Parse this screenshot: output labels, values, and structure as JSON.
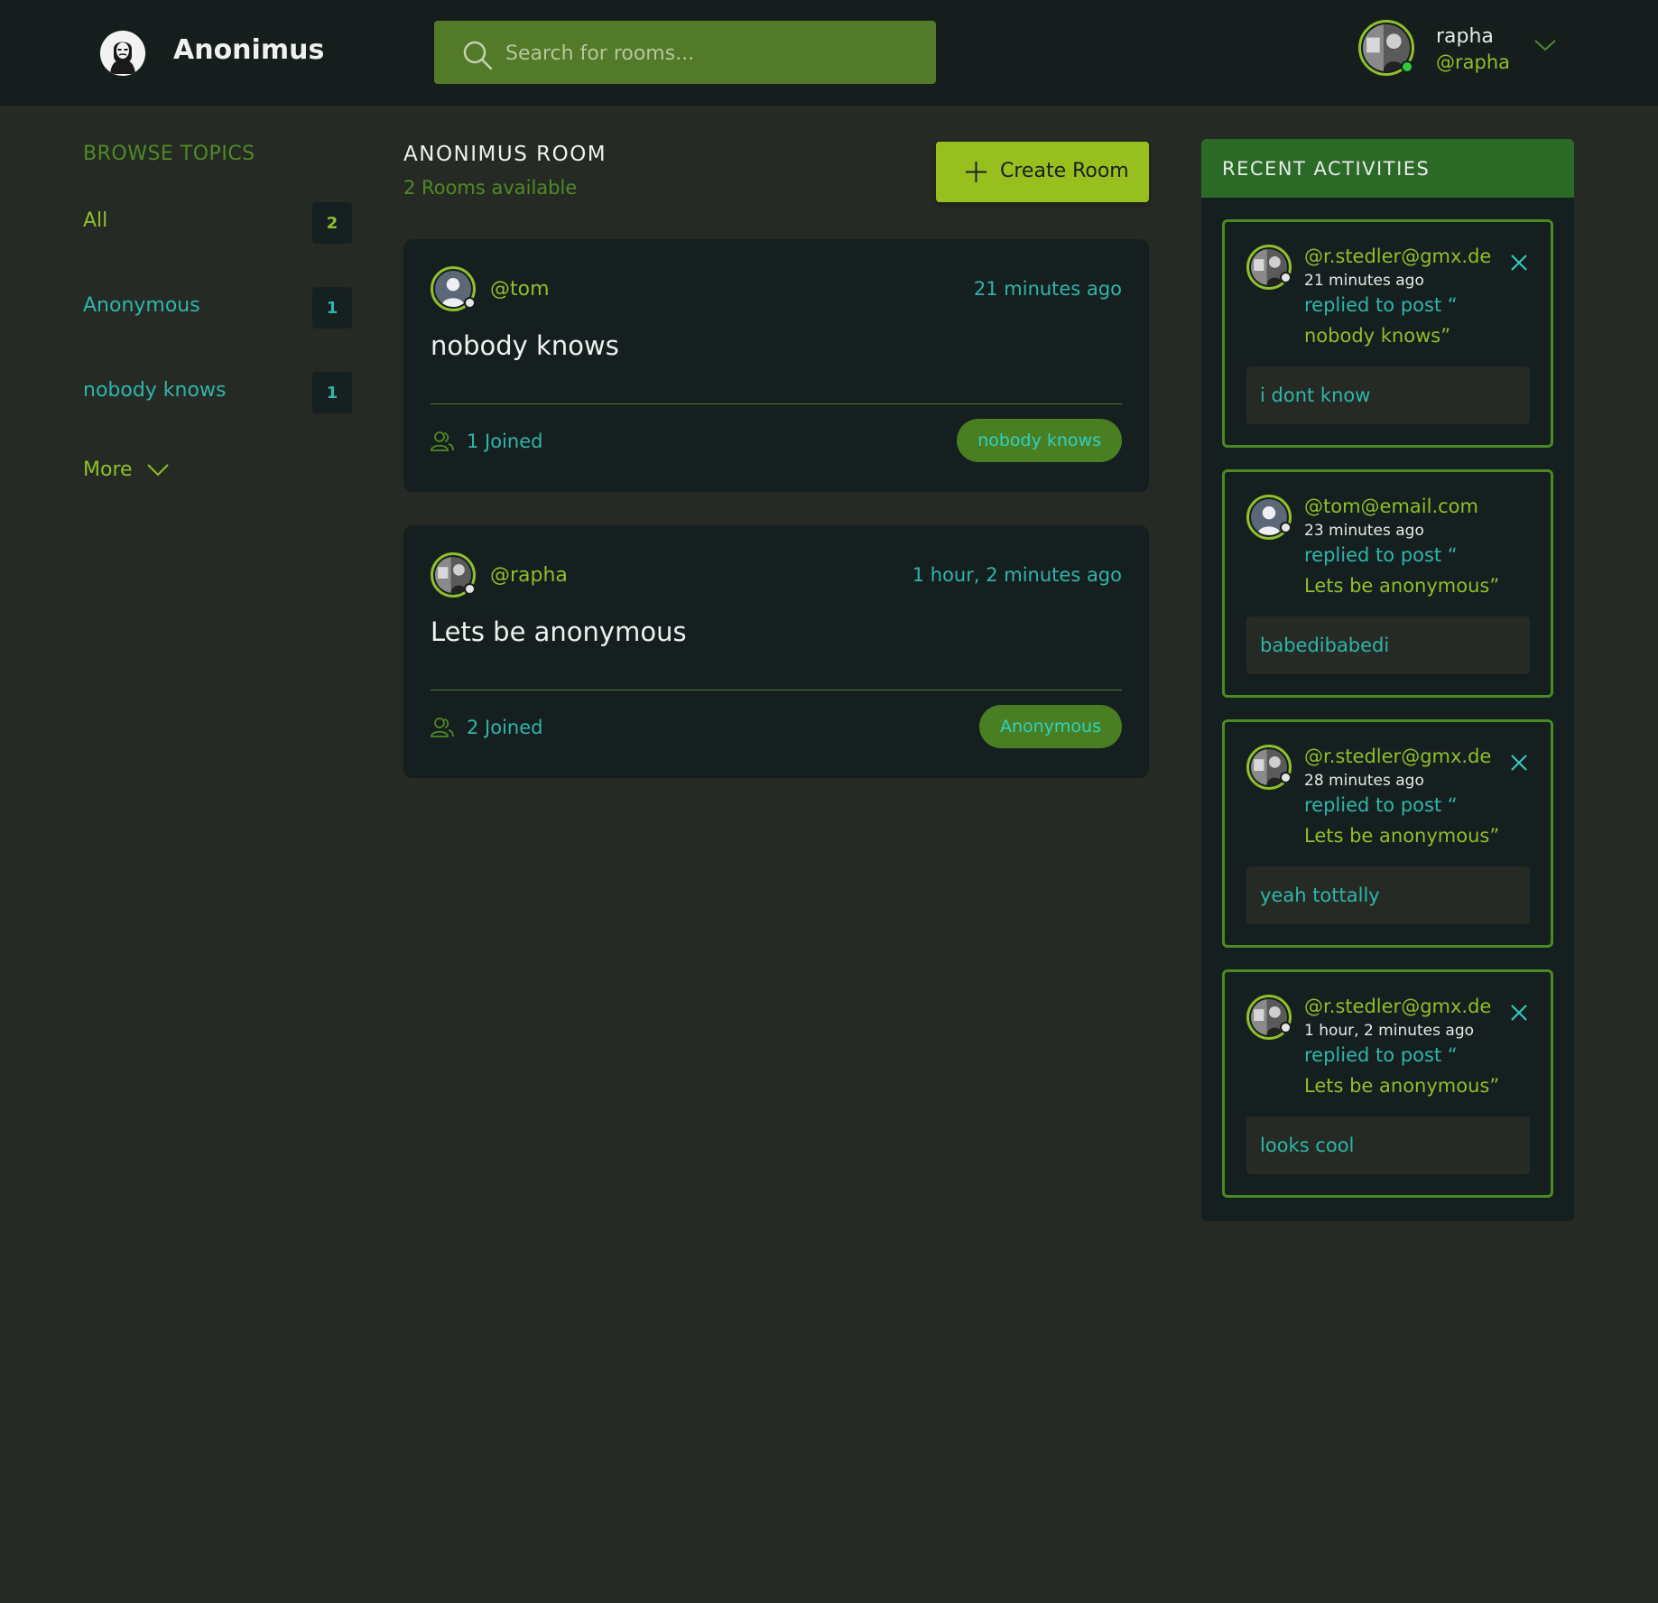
{
  "header": {
    "brand": "Anonimus",
    "search_placeholder": "Search for rooms...",
    "user": {
      "name": "rapha",
      "handle": "@rapha"
    }
  },
  "sidebar": {
    "title": "BROWSE TOPICS",
    "topics": [
      {
        "label": "All",
        "count": "2"
      },
      {
        "label": "Anonymous",
        "count": "1"
      },
      {
        "label": "nobody knows",
        "count": "1"
      }
    ],
    "more_label": "More"
  },
  "main": {
    "title": "ANONIMUS ROOM",
    "subtitle": "2 Rooms available",
    "create_label": "Create Room",
    "rooms": [
      {
        "host": "@tom",
        "time": "21 minutes ago",
        "name": "nobody knows",
        "joined": "1 Joined",
        "topic": "nobody knows"
      },
      {
        "host": "@rapha",
        "time": "1 hour, 2 minutes ago",
        "name": "Lets be anonymous",
        "joined": "2 Joined",
        "topic": "Anonymous"
      }
    ]
  },
  "activities": {
    "title": "RECENT ACTIVITIES",
    "items": [
      {
        "user": "@r.stedler@gmx.de",
        "time": "21 minutes ago",
        "action": "replied to post “",
        "post": "nobody knows”",
        "message": "i dont know"
      },
      {
        "user": "@tom@email.com",
        "time": "23 minutes ago",
        "action": "replied to post “",
        "post": "Lets be anonymous”",
        "message": "babedibabedi"
      },
      {
        "user": "@r.stedler@gmx.de",
        "time": "28 minutes ago",
        "action": "replied to post “",
        "post": "Lets be anonymous”",
        "message": "yeah tottally"
      },
      {
        "user": "@r.stedler@gmx.de",
        "time": "1 hour, 2 minutes ago",
        "action": "replied to post “",
        "post": "Lets be anonymous”",
        "message": "looks cool"
      }
    ]
  },
  "icons": {
    "logo": "anonymous-mask-icon",
    "search": "search-icon",
    "dropdown": "chevron-down-icon",
    "add": "plus-icon",
    "joined": "users-icon",
    "delete": "close-icon"
  },
  "colors": {
    "page_bg": "#262a25",
    "header_bg": "#161d1d",
    "card_bg": "#161f1f",
    "accent_green": "#8fbf2a",
    "button_green": "#97c01f",
    "search_green": "#527a28",
    "teal_text": "#2fb5aa",
    "activities_header": "#2c6a28"
  }
}
